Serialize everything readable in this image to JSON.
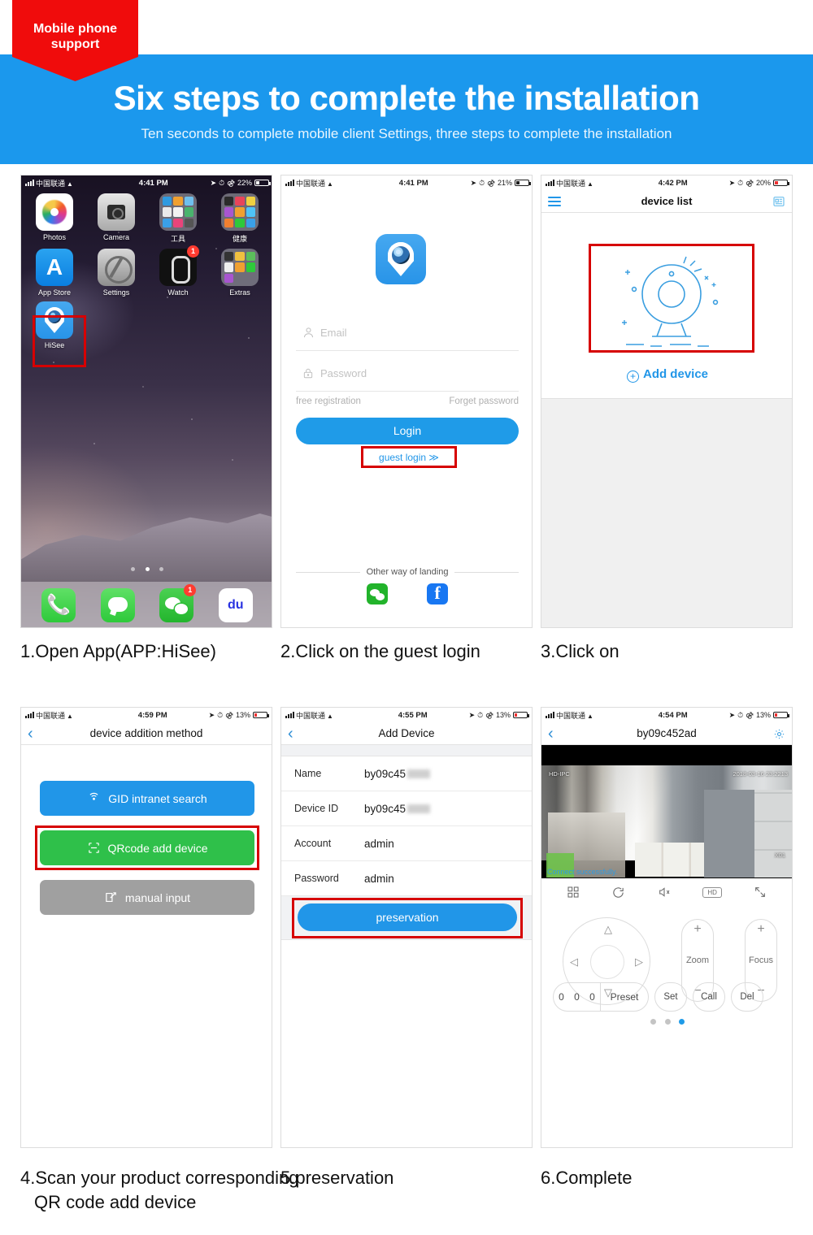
{
  "banner": {
    "ribbon_line1": "Mobile phone",
    "ribbon_line2": "support",
    "title": "Six steps to complete the installation",
    "subtitle": "Ten seconds to complete mobile client Settings, three steps to complete the installation",
    "blue": "#1b98ed",
    "red": "#f00c0c"
  },
  "captions": {
    "step1": "1.Open App(APP:HiSee)",
    "step2": "2.Click on the guest login",
    "step3": "3.Click on",
    "step4_line1": "4.Scan your product corresponding",
    "step4_line2": "QR code add device",
    "step5": "5.preservation",
    "step6": "6.Complete"
  },
  "step1": {
    "status": {
      "carrier": "中国联通",
      "time": "4:41 PM",
      "battery": "22%"
    },
    "apps_row1": [
      {
        "label": "Photos",
        "icon": "photos-icon",
        "badge": ""
      },
      {
        "label": "Camera",
        "icon": "camera-icon",
        "badge": ""
      },
      {
        "label": "工具",
        "icon": "folder-icon",
        "badge": ""
      },
      {
        "label": "健康",
        "icon": "folder-icon",
        "badge": ""
      }
    ],
    "apps_row2": [
      {
        "label": "App Store",
        "icon": "appstore-icon",
        "badge": ""
      },
      {
        "label": "Settings",
        "icon": "settings-icon",
        "badge": ""
      },
      {
        "label": "Watch",
        "icon": "watch-icon",
        "badge": "1"
      },
      {
        "label": "Extras",
        "icon": "folder-icon",
        "badge": ""
      }
    ],
    "apps_row3": [
      {
        "label": "HiSee",
        "icon": "hisee-app-icon",
        "badge": ""
      }
    ],
    "dock": [
      {
        "label": "Phone",
        "icon": "phone-icon",
        "badge": ""
      },
      {
        "label": "Messages",
        "icon": "messages-icon",
        "badge": ""
      },
      {
        "label": "WeChat",
        "icon": "wechat-icon",
        "badge": "1"
      },
      {
        "label": "Baidu",
        "icon": "baidu-icon",
        "badge": ""
      }
    ]
  },
  "step2": {
    "status": {
      "carrier": "中国联通",
      "time": "4:41 PM",
      "battery": "21%"
    },
    "email_placeholder": "Email",
    "password_placeholder": "Password",
    "free_registration": "free registration",
    "forget_password": "Forget password",
    "login_button": "Login",
    "guest_login": "guest login ≫",
    "other_way": "Other way of landing",
    "socials": [
      "wechat-icon",
      "facebook-icon"
    ]
  },
  "step3": {
    "status": {
      "carrier": "中国联通",
      "time": "4:42 PM",
      "battery": "20%"
    },
    "title": "device list",
    "menu_icon": "hamburger-menu-icon",
    "right_icon": "device-card-icon",
    "add_device": "Add device"
  },
  "step4": {
    "status": {
      "carrier": "中国联通",
      "time": "4:59 PM",
      "battery": "13%"
    },
    "title": "device addition method",
    "back_icon": "back-chevron-icon",
    "buttons": [
      {
        "label": "GID intranet search",
        "icon": "wifi-signal-icon",
        "color": "#2196e8"
      },
      {
        "label": "QRcode add device",
        "icon": "qrcode-scan-icon",
        "color": "#2fc04a"
      },
      {
        "label": "manual input",
        "icon": "edit-pencil-icon",
        "color": "#a0a0a0"
      }
    ]
  },
  "step5": {
    "status": {
      "carrier": "中国联通",
      "time": "4:55 PM",
      "battery": "13%"
    },
    "title": "Add Device",
    "back_icon": "back-chevron-icon",
    "fields": [
      {
        "label": "Name",
        "value": "by09c45",
        "masked": true
      },
      {
        "label": "Device ID",
        "value": "by09c45",
        "masked": true
      },
      {
        "label": "Account",
        "value": "admin",
        "masked": false
      },
      {
        "label": "Password",
        "value": "admin",
        "masked": false
      }
    ],
    "save_button": "preservation"
  },
  "step6": {
    "status": {
      "carrier": "中国联通",
      "time": "4:54 PM",
      "battery": "13%"
    },
    "title": "by09c452ad",
    "back_icon": "back-chevron-icon",
    "gear_icon": "gear-icon",
    "video_overlay_label": "HD-IPC",
    "video_timestamp": "2018-03-16 23:2213",
    "video_channel": "X01",
    "connect_status": "Connect successfully.",
    "toolbar": [
      "grid-icon",
      "rotate-icon",
      "mute-icon",
      "hd-badge",
      "fullscreen-icon"
    ],
    "hd_label": "HD",
    "zoom_label": "Zoom",
    "focus_label": "Focus",
    "preset_digits": [
      "0",
      "0",
      "0"
    ],
    "preset_label": "Preset",
    "set_label": "Set",
    "call_label": "Call",
    "del_label": "Del",
    "page_dots": 3,
    "active_dot": 3
  }
}
